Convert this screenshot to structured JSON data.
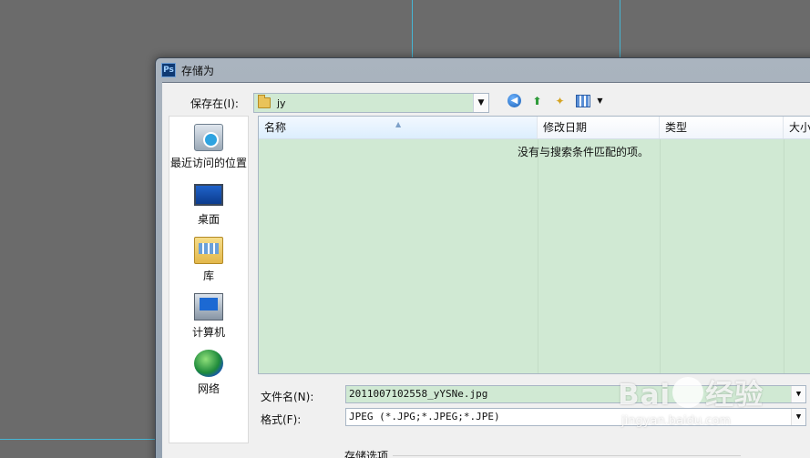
{
  "window": {
    "title": "存储为",
    "app_icon": "Ps"
  },
  "save_in": {
    "label": "保存在(I):",
    "value": "jy"
  },
  "toolbar": {
    "back_icon": "back-icon",
    "up_icon": "up-folder-icon",
    "new_folder_icon": "new-folder-icon",
    "views_icon": "views-menu-icon"
  },
  "places": [
    {
      "label": "最近访问的位置",
      "icon": "recent-places-icon"
    },
    {
      "label": "桌面",
      "icon": "desktop-icon"
    },
    {
      "label": "库",
      "icon": "library-icon"
    },
    {
      "label": "计算机",
      "icon": "computer-icon"
    },
    {
      "label": "网络",
      "icon": "network-icon"
    }
  ],
  "file_list": {
    "columns": [
      "名称",
      "修改日期",
      "类型",
      "大小"
    ],
    "empty_message": "没有与搜索条件匹配的项。"
  },
  "filename": {
    "label": "文件名(N):",
    "value": "2011007102558_yYSNe.jpg"
  },
  "format": {
    "label": "格式(F):",
    "value": "JPEG (*.JPG;*.JPEG;*.JPE)"
  },
  "options": {
    "label": "存储选项"
  },
  "watermark": {
    "main_left": "Bai",
    "main_right": "经验",
    "sub": "jingyan.baidu.com"
  },
  "colors": {
    "list_bg": "#d0e9d3",
    "canvas_bg": "#6b6b6b",
    "guide": "#3fc3e6"
  }
}
